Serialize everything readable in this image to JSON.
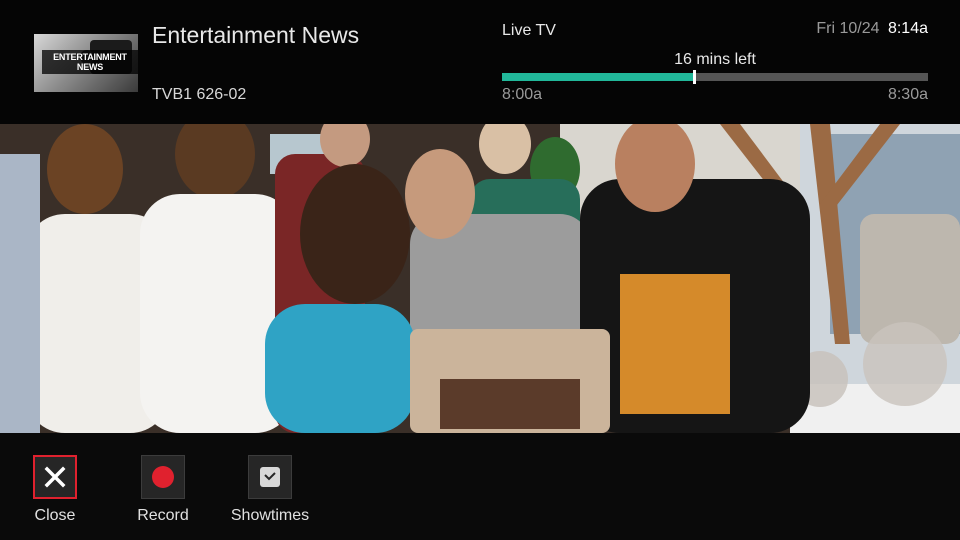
{
  "header": {
    "thumbnail_text": "ENTERTAINMENT NEWS",
    "show_title": "Entertainment News",
    "channel": "TVB1 626-02",
    "source_label": "Live TV",
    "date": "Fri 10/24",
    "time": "8:14a",
    "remaining": "16 mins left",
    "start_time": "8:00a",
    "end_time": "8:30a",
    "progress_fraction": 0.45
  },
  "actions": [
    {
      "label": "Close",
      "icon": "close-icon",
      "focused": true
    },
    {
      "label": "Record",
      "icon": "record-icon",
      "focused": false
    },
    {
      "label": "Showtimes",
      "icon": "clock-icon",
      "focused": false
    }
  ],
  "colors": {
    "accent": "#21b89a",
    "record": "#e0212e",
    "focus": "#e0212e"
  }
}
